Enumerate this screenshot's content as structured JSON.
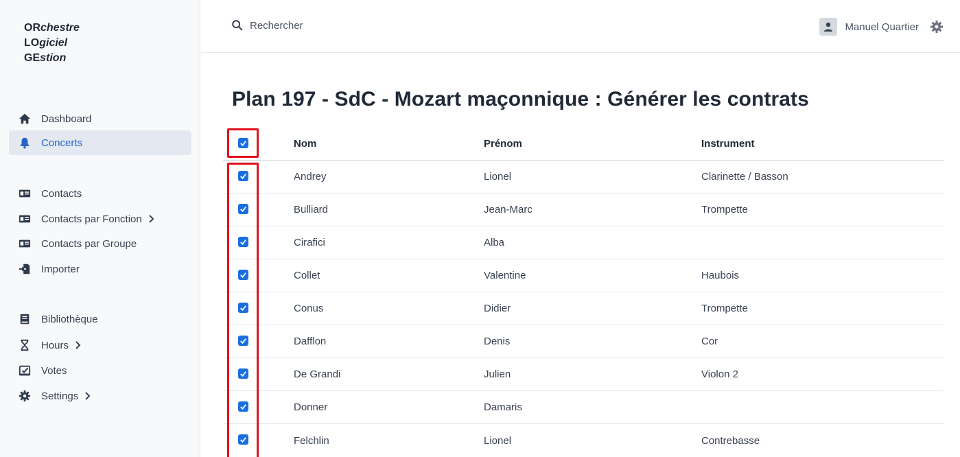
{
  "app": {
    "brand": [
      {
        "caps": "OR",
        "rest": "chestre"
      },
      {
        "caps": "LO",
        "rest": "giciel"
      },
      {
        "caps": "GE",
        "rest": "stion"
      }
    ]
  },
  "sidebar": {
    "items": [
      {
        "label": "Dashboard",
        "icon": "home-icon"
      },
      {
        "label": "Concerts",
        "icon": "bell-icon",
        "active": true
      },
      {
        "label": "Contacts",
        "icon": "id-card-icon"
      },
      {
        "label": "Contacts par Fonction",
        "icon": "id-card-icon",
        "chevron": true
      },
      {
        "label": "Contacts par Groupe",
        "icon": "id-card-icon"
      },
      {
        "label": "Importer",
        "icon": "import-icon"
      },
      {
        "label": "Bibliothèque",
        "icon": "book-icon"
      },
      {
        "label": "Hours",
        "icon": "hourglass-icon",
        "chevron": true
      },
      {
        "label": "Votes",
        "icon": "vote-icon"
      },
      {
        "label": "Settings",
        "icon": "gear-icon",
        "chevron": true
      }
    ]
  },
  "topbar": {
    "search_label": "Rechercher",
    "user_name": "Manuel Quartier"
  },
  "page": {
    "title": "Plan 197 - SdC - Mozart maçonnique : Générer les contrats"
  },
  "table": {
    "headers": {
      "nom": "Nom",
      "prenom": "Prénom",
      "instrument": "Instrument"
    },
    "select_all_checked": true,
    "rows": [
      {
        "nom": "Andrey",
        "prenom": "Lionel",
        "instrument": "Clarinette / Basson",
        "checked": true
      },
      {
        "nom": "Bulliard",
        "prenom": "Jean-Marc",
        "instrument": "Trompette",
        "checked": true
      },
      {
        "nom": "Cirafici",
        "prenom": "Alba",
        "instrument": "",
        "checked": true
      },
      {
        "nom": "Collet",
        "prenom": "Valentine",
        "instrument": "Haubois",
        "checked": true
      },
      {
        "nom": "Conus",
        "prenom": "Didier",
        "instrument": "Trompette",
        "checked": true
      },
      {
        "nom": "Dafflon",
        "prenom": "Denis",
        "instrument": "Cor",
        "checked": true
      },
      {
        "nom": "De Grandi",
        "prenom": "Julien",
        "instrument": "Violon 2",
        "checked": true
      },
      {
        "nom": "Donner",
        "prenom": "Damaris",
        "instrument": "",
        "checked": true
      },
      {
        "nom": "Felchlin",
        "prenom": "Lionel",
        "instrument": "Contrebasse",
        "checked": true
      }
    ]
  },
  "colors": {
    "accent": "#2563c9",
    "checkbox": "#1a6fe0",
    "highlight": "#e0101a"
  }
}
